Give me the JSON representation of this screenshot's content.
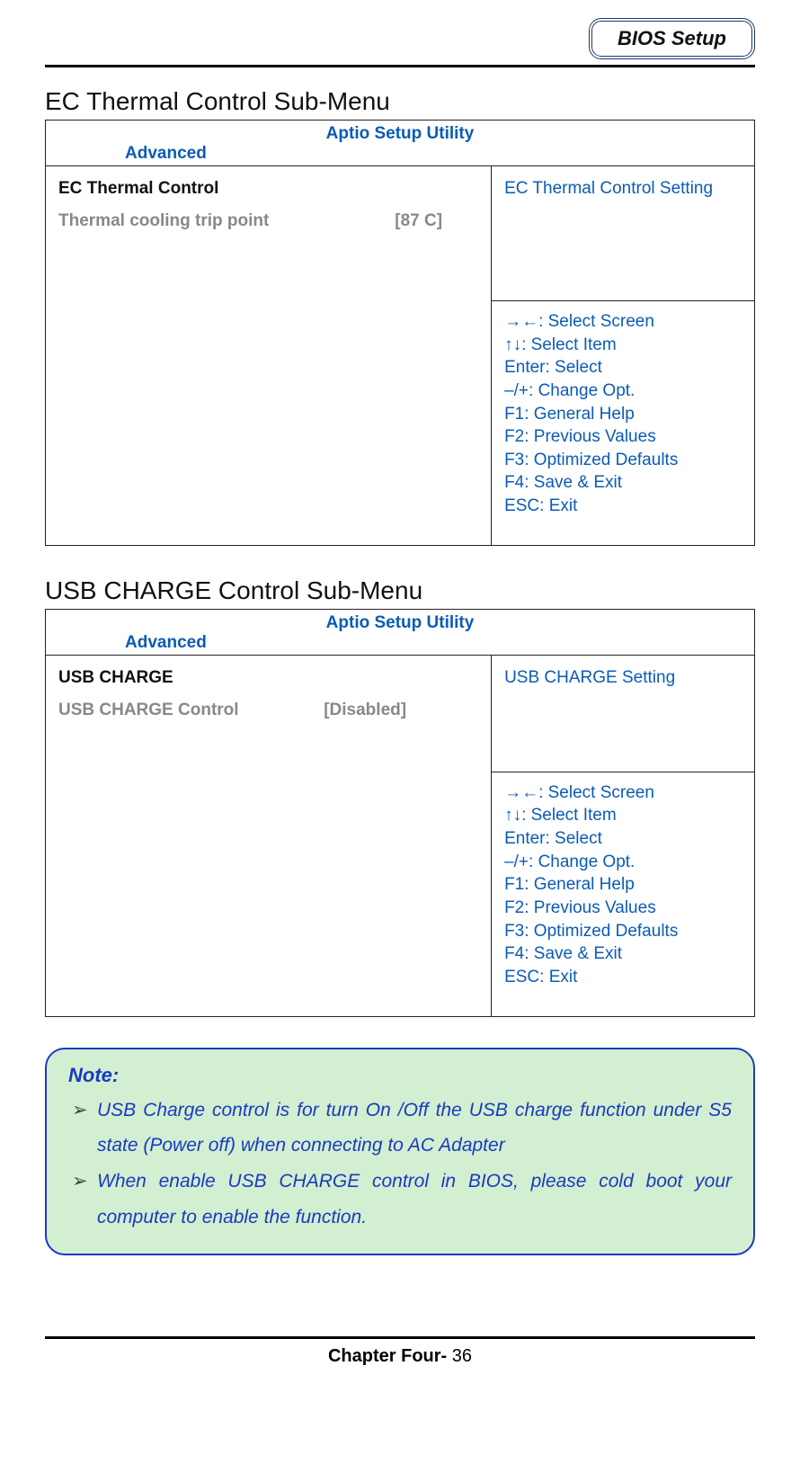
{
  "header": {
    "chapter_title": "BIOS Setup"
  },
  "sections": {
    "ec_thermal": {
      "heading": "EC Thermal Control Sub-Menu",
      "utility_title": "Aptio Setup Utility",
      "tab": "Advanced",
      "group_title": "EC Thermal Control",
      "setting_label": "Thermal cooling trip point",
      "setting_value": "[87 C]",
      "help_text": "EC Thermal Control Setting",
      "keys": [
        "→←: Select Screen",
        "↑↓: Select Item",
        "Enter: Select",
        "–/+: Change Opt.",
        "F1: General Help",
        "F2: Previous Values",
        "F3: Optimized Defaults",
        "F4: Save & Exit",
        "ESC: Exit"
      ]
    },
    "usb_charge": {
      "heading": "USB CHARGE Control Sub-Menu",
      "utility_title": "Aptio Setup Utility",
      "tab": "Advanced",
      "group_title": "USB CHARGE",
      "setting_label": "USB CHARGE Control",
      "setting_value": "[Disabled]",
      "help_text": "USB CHARGE Setting",
      "keys": [
        "→←: Select Screen",
        "↑↓: Select Item",
        "Enter: Select",
        "–/+: Change Opt.",
        "F1: General Help",
        "F2: Previous Values",
        "F3: Optimized Defaults",
        "F4: Save & Exit",
        "ESC: Exit"
      ]
    }
  },
  "note": {
    "title": "Note:",
    "items": [
      "USB Charge control is for turn On /Off the USB charge function under S5 state (Power off) when connecting to AC Adapter",
      "When enable USB CHARGE control in BIOS, please cold boot your computer to enable the function."
    ]
  },
  "footer": {
    "chapter": "Chapter Four- ",
    "page": "36"
  }
}
